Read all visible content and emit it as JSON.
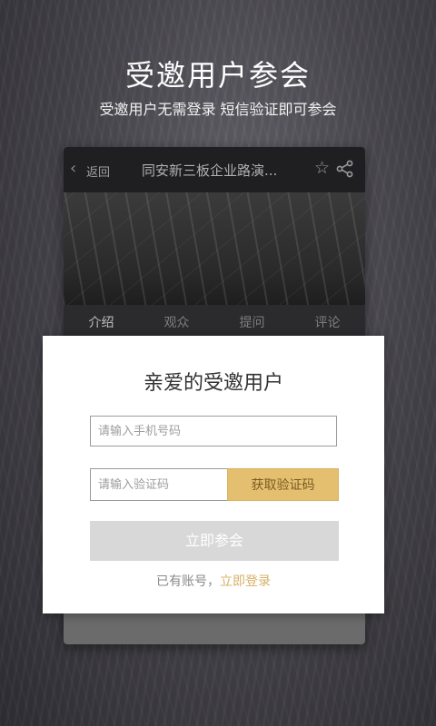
{
  "header": {
    "title": "受邀用户参会",
    "subtitle": "受邀用户无需登录  短信验证即可参会"
  },
  "background_page": {
    "back_label": "返回",
    "title": "同安新三板企业路演...",
    "icons": [
      "star-icon",
      "share-icon",
      "chevron-left-icon"
    ],
    "tabs": [
      {
        "label": "介绍",
        "active": true
      },
      {
        "label": "观众",
        "active": false
      },
      {
        "label": "提问",
        "active": false
      },
      {
        "label": "评论",
        "active": false
      }
    ]
  },
  "modal": {
    "title": "亲爱的受邀用户",
    "phone_placeholder": "请输入手机号码",
    "phone_value": "",
    "code_placeholder": "请输入验证码",
    "code_value": "",
    "get_code_label": "获取验证码",
    "join_label": "立即参会",
    "login_prefix": "已有账号，",
    "login_link": "立即登录"
  },
  "colors": {
    "accent": "#e4bf6f",
    "link": "#d8b068",
    "disabled_button": "#d8d8d8",
    "modal_bg": "#ffffff"
  }
}
